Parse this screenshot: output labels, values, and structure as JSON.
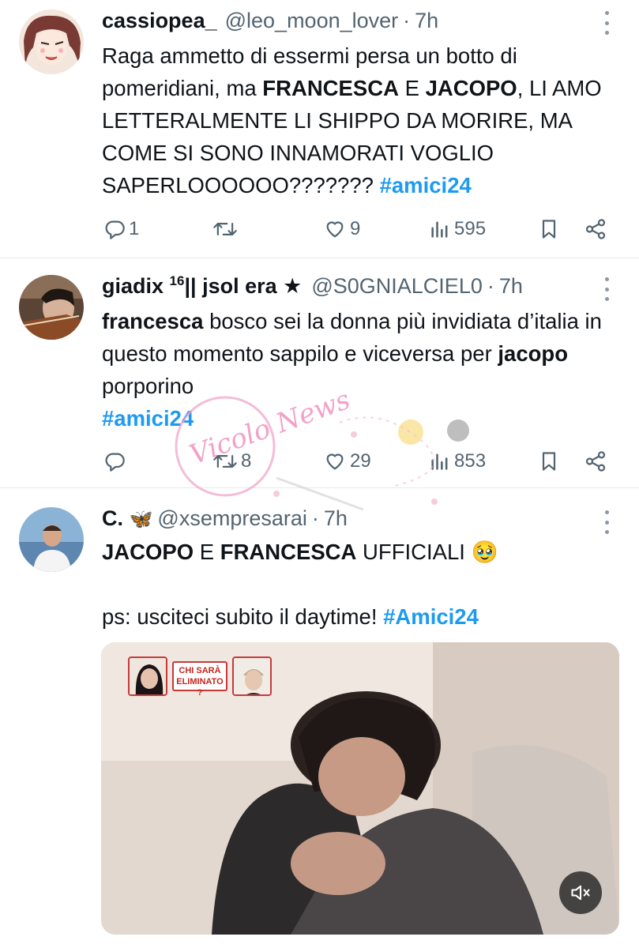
{
  "tweets": [
    {
      "name": "cassiopea_",
      "handle": "@leo_moon_lover",
      "sep": "·",
      "time": "7h",
      "body": [
        {
          "t": "Raga ammetto di essermi persa un botto di pomeridiani, ma "
        },
        {
          "t": "FRANCESCA",
          "b": true
        },
        {
          "t": " E "
        },
        {
          "t": "JACOPO",
          "b": true
        },
        {
          "t": ", LI AMO LETTERALMENTE LI SHIPPO DA MORIRE, MA COME SI SONO INNAMORATI VOGLIO SAPERLOOOOOO??????? "
        },
        {
          "t": "#amici24",
          "tag": true
        }
      ],
      "replies": "1",
      "retweets": "",
      "likes": "9",
      "views": "595"
    },
    {
      "name": "giadix",
      "name_sup": "16",
      "name_rest": "|| jsol era ★",
      "handle": "@S0GNIALCIEL0",
      "sep": "·",
      "time": "7h",
      "body": [
        {
          "t": "francesca",
          "b": true
        },
        {
          "t": " bosco sei la donna più invidiata d’italia in questo momento sappilo e viceversa per "
        },
        {
          "t": "jacopo",
          "b": true
        },
        {
          "t": " porporino"
        }
      ],
      "body_tag": "#amici24",
      "replies": "",
      "retweets": "8",
      "likes": "29",
      "views": "853"
    },
    {
      "name": "C.",
      "name_emoji": "🦋",
      "handle": "@xsempresarai",
      "sep": "·",
      "time": "7h",
      "body": [
        {
          "t": "JACOPO",
          "b": true
        },
        {
          "t": " E "
        },
        {
          "t": "FRANCESCA",
          "b": true
        },
        {
          "t": " UFFICIALI "
        }
      ],
      "body_emoji": "🥹",
      "body2_prefix": "ps: usciteci subito il daytime! ",
      "body2_tag": "#Amici24",
      "video_badge": "CHI SARÀ ELIMINATO ?"
    }
  ],
  "watermark_text": "Vicolo News",
  "colors": {
    "accent": "#1d9bf0",
    "muted": "#536471",
    "text": "#0f1419",
    "divider": "#e6e9ec"
  },
  "icons": [
    "reply-icon",
    "retweet-icon",
    "like-icon",
    "views-icon",
    "bookmark-icon",
    "share-icon",
    "more-icon",
    "mute-icon"
  ]
}
